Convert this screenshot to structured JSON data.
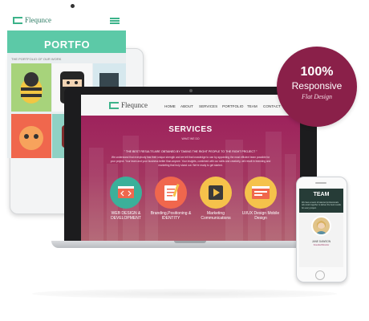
{
  "tablet": {
    "logo_text": "Flequnce",
    "section_title": "PORTFO",
    "sub_text": "THE PORTFOLIO OF OUR WORK"
  },
  "laptop": {
    "logo_text": "Flequnce",
    "nav": [
      "HOME",
      "ABOUT",
      "SERVICES",
      "PORTFOLIO",
      "TEAM",
      "CONTACT"
    ],
    "title": "SERVICES",
    "subtitle": "WHAT WE DO",
    "tagline": "\" THE BEST RESULTS ARE OBTAINED BY TAKING THE RIGHT PEOPLE TO THE RIGHT PROJECT \"",
    "body_lines": [
      "We understand that everybody has their unique strength and we tell that knowledge to use by appointing the most efficient team possible for",
      "your project. Your team and your business better than anyone. Your insights, combined with our skills and creativity, will result in branding and",
      "marketing that truly stand out. We're ready to get started."
    ],
    "services": [
      {
        "label": "WEB DESIGN & DEVELOPMENT",
        "color": "#3bb09a",
        "icon": "code-icon"
      },
      {
        "label": "Branding,Positioning & IDENTITY",
        "color": "#f0674d",
        "icon": "pen-icon"
      },
      {
        "label": "Marketing Communications",
        "color": "#f5c24b",
        "icon": "play-icon"
      },
      {
        "label": "UI/UX Design Mobile Design",
        "color": "#f5c24b",
        "icon": "browser-icon"
      }
    ]
  },
  "badge": {
    "line1": "100%",
    "line2": "Responsive",
    "line3": "Flat Design",
    "color": "#8a2049"
  },
  "phone": {
    "title": "TEAM",
    "intro": "We have a team of talented professionals who work together to deliver the best results for every project.",
    "member_name": "JANE DAWSON",
    "member_role": "Founder/Director"
  },
  "colors": {
    "accent_green": "#5cc9a7",
    "accent_magenta": "#9c1c5b"
  }
}
